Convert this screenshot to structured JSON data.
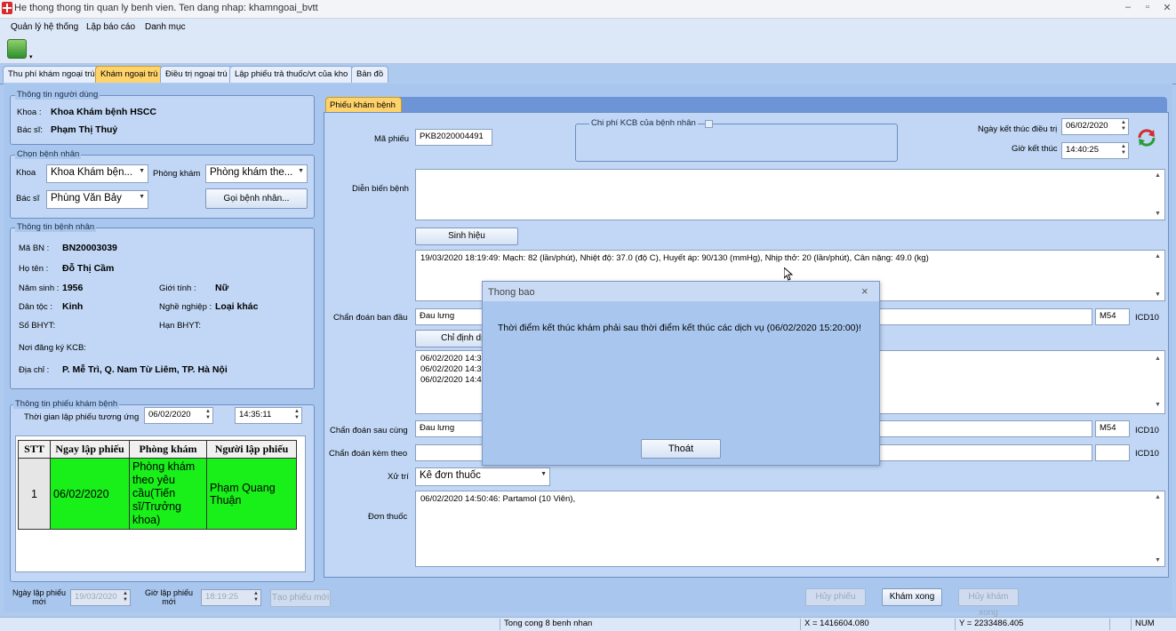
{
  "window": {
    "title": "He thong thong tin quan ly benh vien. Ten dang nhap: khamngoai_bvtt",
    "minimize": "–",
    "maximize": "▫",
    "close": "✕"
  },
  "menu": [
    "Quản lý hệ thống",
    "Lập báo cáo",
    "Danh mục"
  ],
  "toolbar": {
    "icon": "refresh-data-icon",
    "dropdown": "▾"
  },
  "tabs": [
    {
      "label": "Thu phí khám ngoại trú",
      "active": false
    },
    {
      "label": "Khám ngoại trú",
      "active": true
    },
    {
      "label": "Điều trị ngoại trú",
      "active": false
    },
    {
      "label": "Lập phiếu trả thuốc/vt của kho",
      "active": false
    },
    {
      "label": "Bản đồ",
      "active": false
    }
  ],
  "user_info": {
    "legend": "Thông tin người dùng",
    "khoa_label": "Khoa :",
    "khoa_value": "Khoa Khám bệnh  HSCC",
    "bacsi_label": "Bác sĩ:",
    "bacsi_value": "Phạm Thị Thuỷ"
  },
  "select_patient": {
    "legend": "Chọn bệnh nhân",
    "khoa_label": "Khoa",
    "khoa_value": "Khoa Khám bện...",
    "phongkham_label": "Phòng khám",
    "phongkham_value": "Phòng khám the...",
    "bacsi_label": "Bác sĩ",
    "bacsi_value": "Phùng Văn Bảy",
    "call_button": "Gọi bệnh nhân..."
  },
  "patient_info": {
    "legend": "Thông tin bệnh nhân",
    "ma_bn_label": "Mã BN :",
    "ma_bn": "BN20003039",
    "ho_ten_label": "Họ tên :",
    "ho_ten": "Đỗ Thị Cầm",
    "nam_sinh_label": "Năm sinh :",
    "nam_sinh": "1956",
    "gioi_tinh_label": "Giới tính :",
    "gioi_tinh": "Nữ",
    "dan_toc_label": "Dân tộc :",
    "dan_toc": "Kinh",
    "nghe_nghiep_label": "Nghề nghiệp :",
    "nghe_nghiep": "Loại khác",
    "so_bhyt_label": "Số BHYT:",
    "han_bhyt_label": "Hạn BHYT:",
    "noi_dk_label": "Nơi đăng ký KCB:",
    "dia_chi_label": "Địa chỉ :",
    "dia_chi": "P. Mễ Trì, Q. Nam Từ Liêm, TP. Hà Nội"
  },
  "exam_form_info": {
    "legend": "Thông tin phiếu khám bệnh",
    "time_label": "Thời gian lập phiếu tương ứng",
    "date": "06/02/2020",
    "time": "14:35:11",
    "columns": [
      "STT",
      "Ngay lập phiếu",
      "Phòng khám",
      "Người lập phiếu"
    ],
    "rows": [
      {
        "stt": "1",
        "ngay": "06/02/2020",
        "phong": "Phòng khám theo yêu cầu(Tiến sĩ/Trưởng khoa)",
        "nguoi": "Phạm Quang Thuận"
      }
    ]
  },
  "bottom_left": {
    "ngay_label": "Ngày lập phiếu mới",
    "ngay_value": "19/03/2020",
    "gio_label": "Giờ lập phiếu mới",
    "gio_value": "18:19:25",
    "create_button": "Tạo phiếu mới"
  },
  "phieu": {
    "tab": "Phiếu khám bệnh",
    "ma_phieu_label": "Mã phiếu",
    "ma_phieu": "PKB2020004491",
    "chiphi_legend": "Chi phí KCB của bệnh nhân",
    "ngay_ket_thuc_label": "Ngày kết thúc điều trị",
    "ngay_ket_thuc": "06/02/2020",
    "gio_ket_thuc_label": "Giờ kết thúc",
    "gio_ket_thuc": "14:40:25",
    "dien_bien_label": "Diễn biến bệnh",
    "sinh_hieu_button": "Sinh hiệu",
    "sinh_hieu_text": "19/03/2020 18:19:49: Mạch: 82 (lần/phút), Nhiệt độ: 37.0 (độ C), Huyết áp: 90/130 (mmHg), Nhịp thở: 20 (lần/phút), Cân nặng: 49.0 (kg)",
    "chan_doan_ban_dau_label": "Chẩn đoán ban đầu",
    "chan_doan_ban_dau": "Đau lưng",
    "icd_ban_dau": "M54",
    "chi_dinh_button": "Chỉ định dịch",
    "chi_dinh_lines": [
      "06/02/2020 14:37",
      "06/02/2020 14:37",
      "06/02/2020 14:44"
    ],
    "chan_doan_sau_cung_label": "Chẩn đoán sau cùng",
    "chan_doan_sau_cung": "Đau lưng",
    "icd_sau_cung": "M54",
    "chan_doan_kem_theo_label": "Chẩn đoán kèm theo",
    "icd_label": "ICD10",
    "xu_tri_label": "Xử trí",
    "xu_tri": "Kê đơn thuốc",
    "don_thuoc_label": "Đơn thuốc",
    "don_thuoc_text": "06/02/2020 14:50:46:  Partamol (10 Viên),",
    "huy_phieu": "Hủy phiếu",
    "kham_xong": "Khám xong",
    "huy_kham_xong": "Hủy khám xong"
  },
  "dialog": {
    "title": "Thong bao",
    "message": "Thời điểm kết thúc khám phải sau thời điểm kết thúc các dịch vụ (06/02/2020 15:20:00)!",
    "button": "Thoát",
    "close": "×"
  },
  "status": {
    "count": "Tong cong 8 benh nhan",
    "x": "X = 1416604.080",
    "y": "Y = 2233486.405",
    "num": "NUM"
  }
}
